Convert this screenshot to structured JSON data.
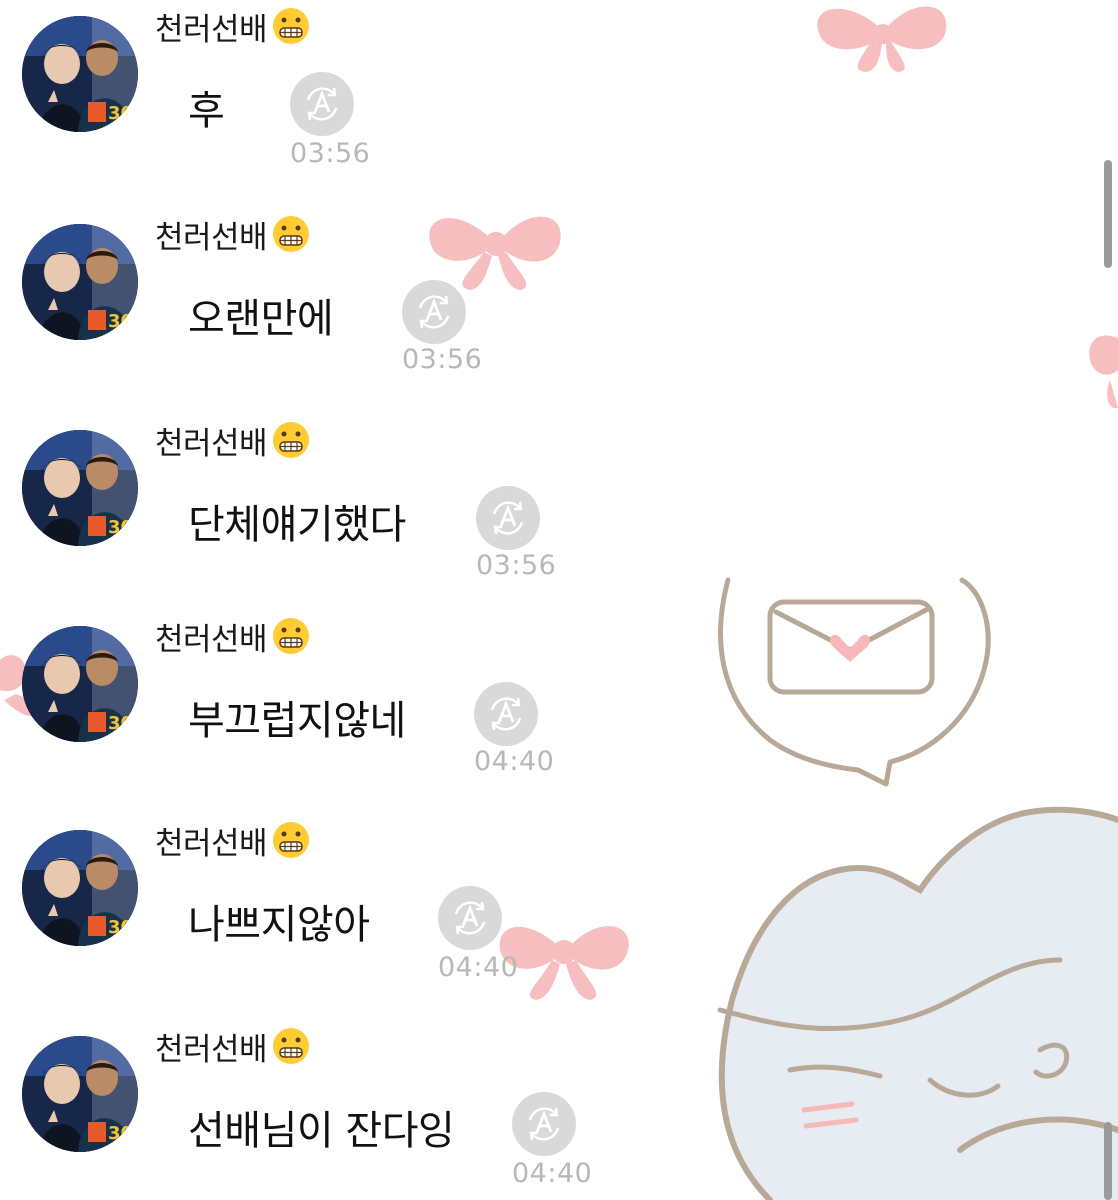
{
  "colors": {
    "background": "#ffffff",
    "text": "#111111",
    "timestamp": "#b8b8b8",
    "translate_button": "#d9d9d9",
    "bow_pink": "#f6b8b8",
    "sketch_brown": "#b8a898",
    "sketch_fill": "#e7ecf2"
  },
  "chat": {
    "messages": [
      {
        "sender": "천러선배",
        "sender_emoji": "grimacing-face-icon",
        "text": "후",
        "time": "03:56"
      },
      {
        "sender": "천러선배",
        "sender_emoji": "grimacing-face-icon",
        "text": "오랜만에",
        "time": "03:56"
      },
      {
        "sender": "천러선배",
        "sender_emoji": "grimacing-face-icon",
        "text": "단체얘기했다",
        "time": "03:56"
      },
      {
        "sender": "천러선배",
        "sender_emoji": "grimacing-face-icon",
        "text": "부끄럽지않네",
        "time": "04:40"
      },
      {
        "sender": "천러선배",
        "sender_emoji": "grimacing-face-icon",
        "text": "나쁘지않아",
        "time": "04:40"
      },
      {
        "sender": "천러선배",
        "sender_emoji": "grimacing-face-icon",
        "text": "선배님이 잔다잉",
        "time": "04:40"
      }
    ],
    "translate_icon": "translate-a-icon"
  }
}
